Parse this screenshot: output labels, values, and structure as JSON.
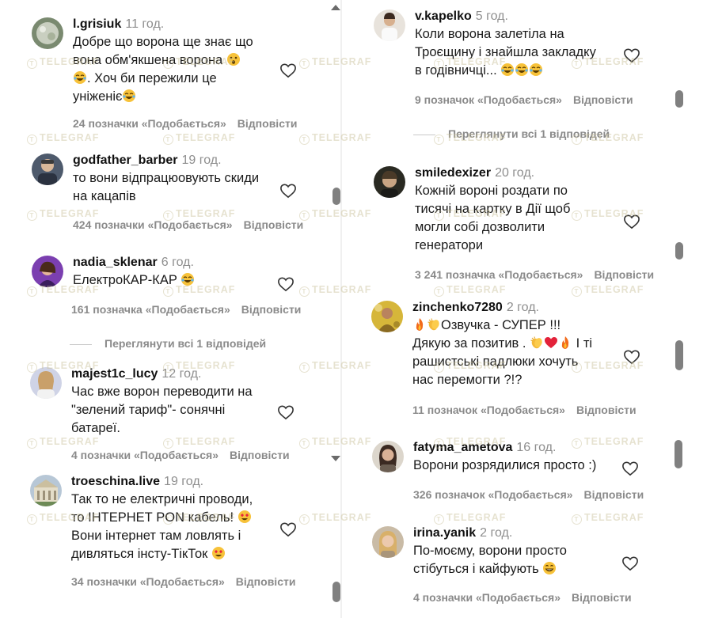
{
  "left": [
    {
      "user": "l.grisiuk",
      "time": "11 год.",
      "lines": [
        "Добре що ворона ще знає що",
        "вона обм'якшена ворона 😮",
        "😂. Хоч би пережили це",
        "уніженіє😂"
      ],
      "likes": "24 позначки «Подобається»",
      "reply": "Відповісти"
    },
    {
      "user": "godfather_barber",
      "time": "19 год.",
      "lines": [
        "то вони відпрацюовують скиди",
        "на кацапів"
      ],
      "likes": "424 позначки «Подобається»",
      "reply": "Відповісти"
    },
    {
      "user": "nadia_sklenar",
      "time": "6 год.",
      "lines": [
        "ЕлектроКАР-КАР 😂"
      ],
      "likes": "161 позначка «Подобається»",
      "reply": "Відповісти",
      "replies": "Переглянути всі 1 відповідей"
    },
    {
      "user": "majest1c_lucy",
      "time": "12 год.",
      "lines": [
        "Час вже ворон переводити на",
        "\"зелений тариф\"- сонячні",
        "батареї."
      ],
      "likes": "4 позначки «Подобається»",
      "reply": "Відповісти"
    },
    {
      "user": "troeschina.live",
      "time": "19 год.",
      "lines": [
        "Так то не електричні проводи,",
        "то ІНТЕРНЕТ PON кабель! 😍",
        "Вони інтернет там ловлять і",
        "дивляться інсту-ТікТок 😍"
      ],
      "likes": "34 позначки «Подобається»",
      "reply": "Відповісти"
    }
  ],
  "right": [
    {
      "user": "v.kapelko",
      "time": "5 год.",
      "lines": [
        "Коли ворона залетіла на",
        "Троєщину і знайшла закладку",
        "в годівничці... 😂😂😂"
      ],
      "likes": "9 позначок «Подобається»",
      "reply": "Відповісти",
      "replies": "Переглянути всі 1 відповідей"
    },
    {
      "user": "smiledexizer",
      "time": "20 год.",
      "lines": [
        "Кожній вороні роздати по",
        "тисячі на картку в Дії щоб",
        "могли собі дозволити",
        "генератори"
      ],
      "likes": "3 241 позначка «Подобається»",
      "reply": "Відповісти"
    },
    {
      "user": "zinchenko7280",
      "time": "2 год.",
      "lines": [
        "🔥👏Озвучка - СУПЕР !!!",
        "Дякую за позитив . 👏❤️🔥 І ті",
        "рашистські падлюки хочуть",
        "нас перемогти ?!?"
      ],
      "likes": "11 позначок «Подобається»",
      "reply": "Відповісти"
    },
    {
      "user": "fatyma_ametova",
      "time": "16 год.",
      "lines": [
        "Ворони розрядилися просто :)"
      ],
      "likes": "326 позначок «Подобається»",
      "reply": "Відповісти"
    },
    {
      "user": "irina.yanik",
      "time": "2 год.",
      "lines": [
        "По-моєму, ворони просто",
        "стібуться і кайфують 😁"
      ],
      "likes": "4 позначки «Подобається»",
      "reply": "Відповісти"
    }
  ],
  "watermark": "TELEGRAF",
  "colors": {
    "muted": "#8e8e8e",
    "text": "#1a1a1a",
    "scrollbar": "#808080"
  }
}
